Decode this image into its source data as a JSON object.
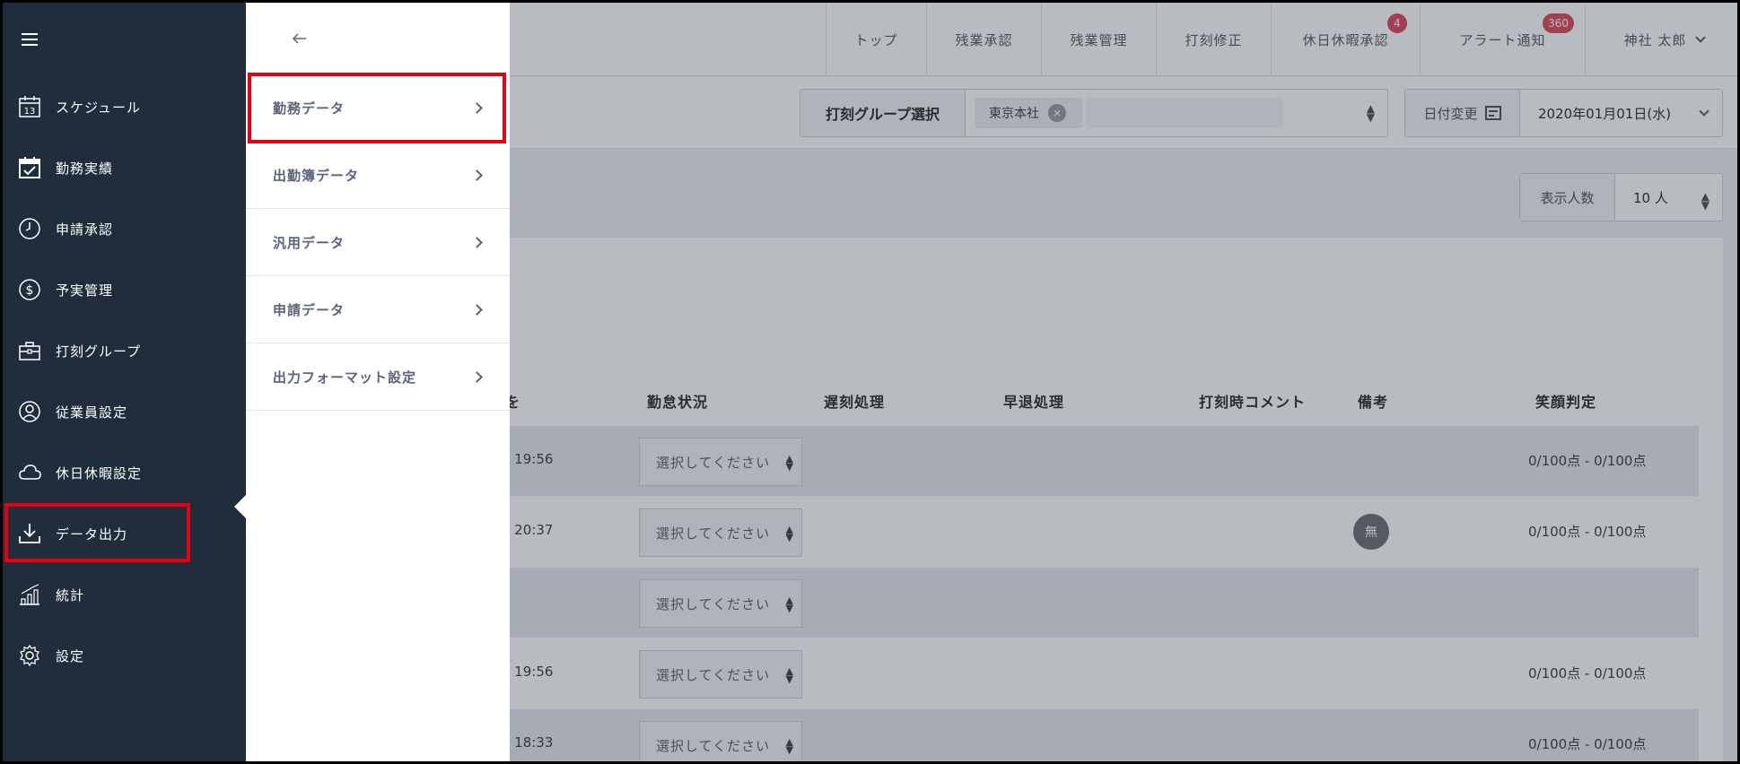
{
  "topnav": {
    "items": [
      {
        "label": "トップ"
      },
      {
        "label": "残業承認"
      },
      {
        "label": "残業管理"
      },
      {
        "label": "打刻修正"
      },
      {
        "label": "休日休暇承認",
        "badge": "4"
      },
      {
        "label": "アラート通知",
        "badge": "360"
      }
    ],
    "user": "神社 太郎"
  },
  "filter": {
    "group_label": "打刻グループ選択",
    "group_tag": "東京本社",
    "date_label": "日付変更",
    "date_value": "2020年01月01日(水)"
  },
  "display_count": {
    "label": "表示人数",
    "value": "10 人"
  },
  "table": {
    "headers": {
      "status": "勤怠状況",
      "late": "遅刻処理",
      "early": "早退処理",
      "comment": "打刻時コメント",
      "note": "備考",
      "smile": "笑顔判定"
    },
    "header_partial": "を",
    "rows": [
      {
        "time": "- 19:56",
        "select": "選択してください",
        "note": "",
        "score": "0/100点 - 0/100点"
      },
      {
        "time": "- 20:37",
        "select": "選択してください",
        "note": "無",
        "score": "0/100点 - 0/100点"
      },
      {
        "time": "",
        "select": "選択してください",
        "note": "",
        "score": ""
      },
      {
        "time": "- 19:56",
        "select": "選択してください",
        "note": "",
        "score": "0/100点 - 0/100点"
      },
      {
        "time": "- 18:33",
        "select": "選択してください",
        "note": "",
        "score": "0/100点 - 0/100点"
      }
    ]
  },
  "sidebar": {
    "items": [
      {
        "label": "スケジュール",
        "icon": "calendar-icon",
        "icon_text": "13"
      },
      {
        "label": "勤務実績",
        "icon": "calendar-check-icon"
      },
      {
        "label": "申請承認",
        "icon": "clock-icon"
      },
      {
        "label": "予実管理",
        "icon": "dollar-icon"
      },
      {
        "label": "打刻グループ",
        "icon": "briefcase-icon"
      },
      {
        "label": "従業員設定",
        "icon": "user-icon"
      },
      {
        "label": "休日休暇設定",
        "icon": "cloud-icon"
      },
      {
        "label": "データ出力",
        "icon": "download-icon"
      },
      {
        "label": "統計",
        "icon": "chart-icon"
      },
      {
        "label": "設定",
        "icon": "gear-icon"
      }
    ]
  },
  "submenu": {
    "items": [
      {
        "label": "勤務データ"
      },
      {
        "label": "出勤簿データ"
      },
      {
        "label": "汎用データ"
      },
      {
        "label": "申請データ"
      },
      {
        "label": "出力フォーマット設定"
      }
    ]
  },
  "colors": {
    "sidebar_bg": "#1f2d3d",
    "highlight": "#e60012",
    "badge": "#e05060"
  }
}
